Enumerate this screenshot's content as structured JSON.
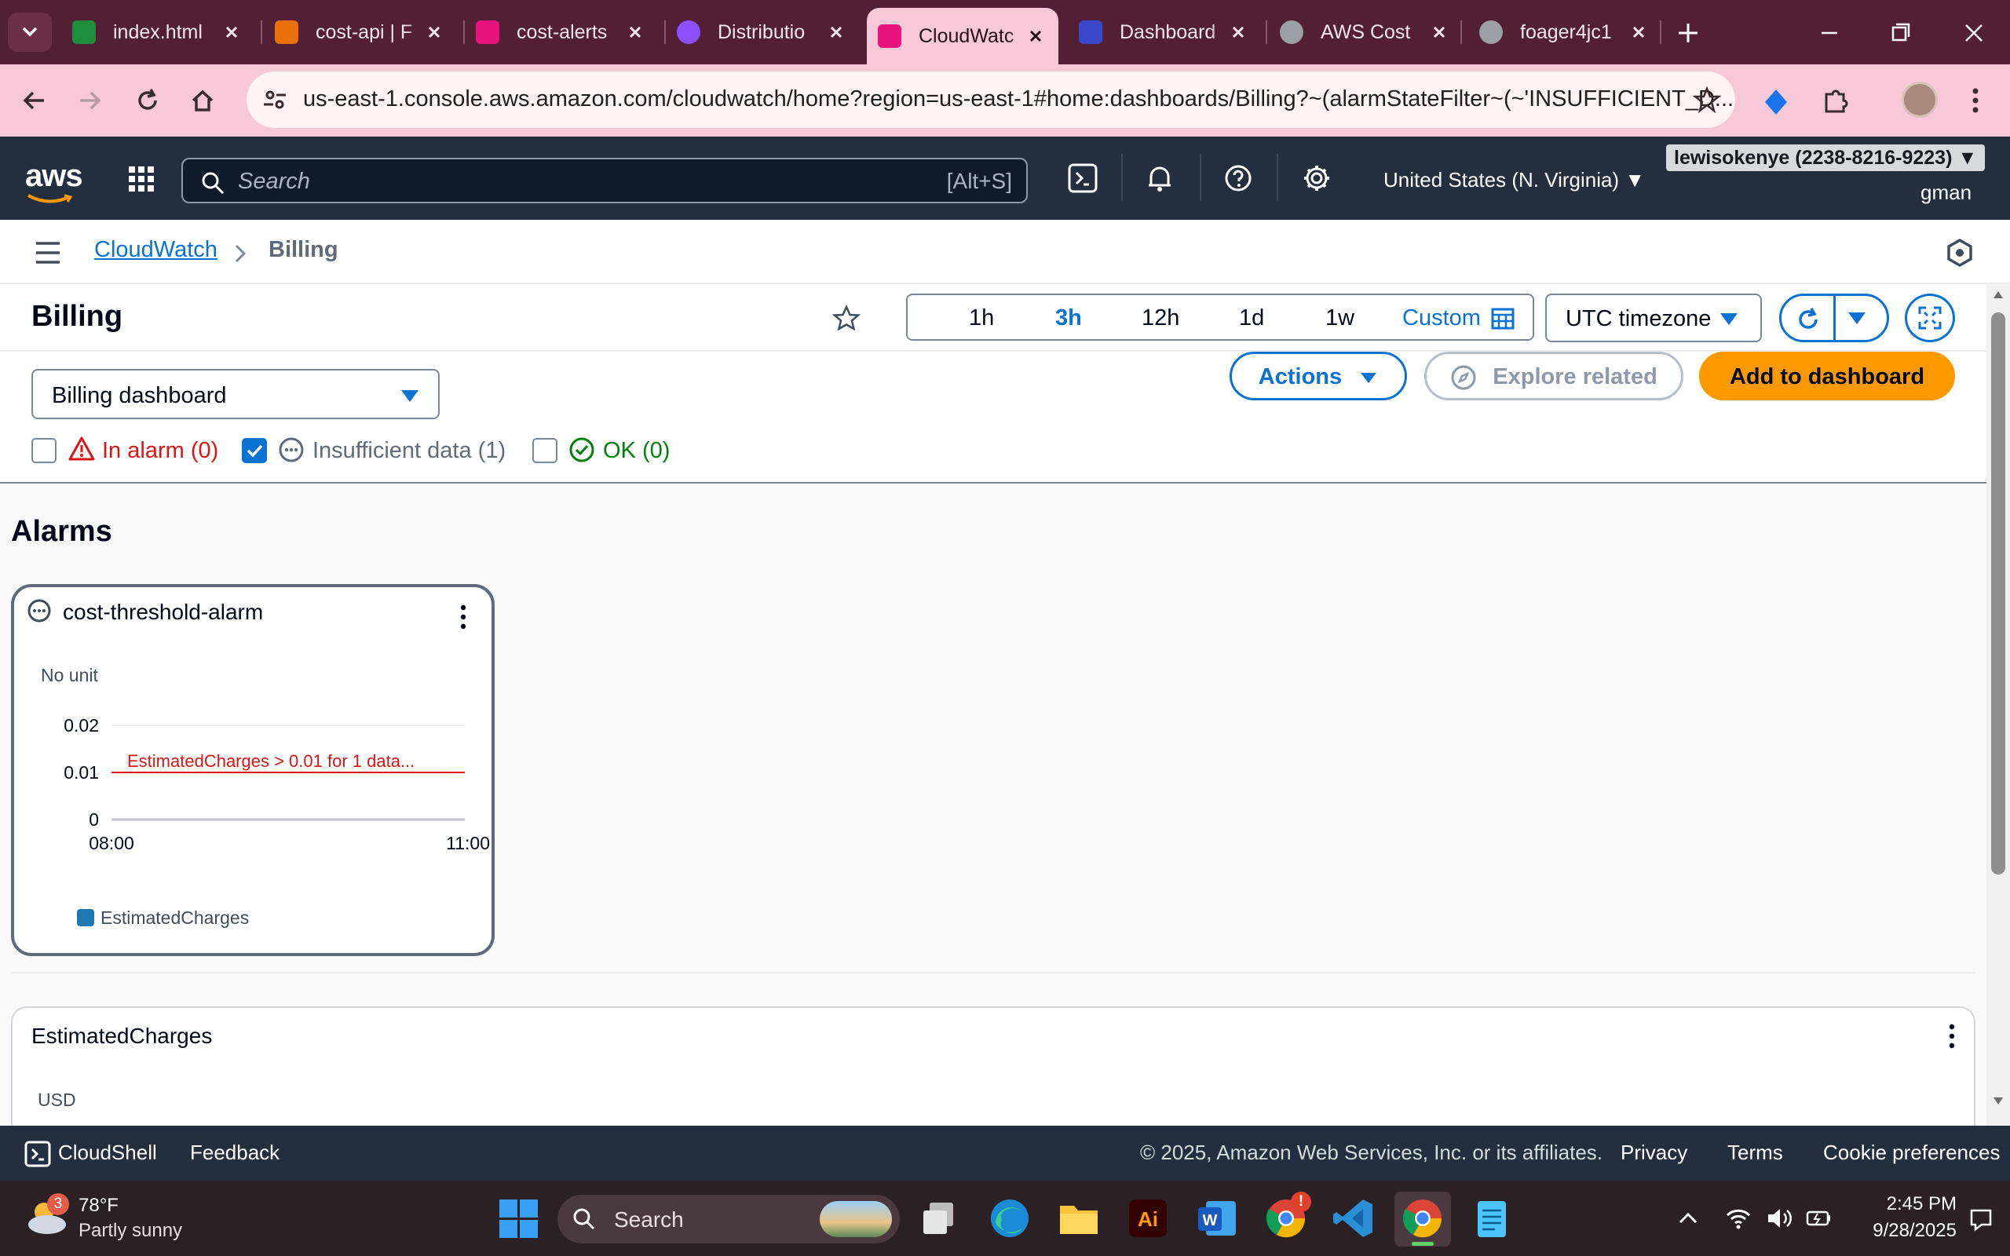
{
  "browser": {
    "tabs": [
      {
        "title": "index.html",
        "icon": "file-icon",
        "color": "#1e8e3e"
      },
      {
        "title": "cost-api | F",
        "icon": "lambda-icon",
        "color": "#e8710a"
      },
      {
        "title": "cost-alerts",
        "icon": "sns-icon",
        "color": "#e7157b"
      },
      {
        "title": "Distributio",
        "icon": "cloudfront-icon",
        "color": "#8c4fff"
      },
      {
        "title": "CloudWatc",
        "icon": "cloudwatch-icon",
        "color": "#e7157b"
      },
      {
        "title": "Dashboard",
        "icon": "dashboard-icon",
        "color": "#3b48cc"
      },
      {
        "title": "AWS Cost",
        "icon": "globe-icon",
        "color": "#9aa0a6"
      },
      {
        "title": "foager4jc1",
        "icon": "globe-icon",
        "color": "#9aa0a6"
      }
    ],
    "url": "us-east-1.console.aws.amazon.com/cloudwatch/home?region=us-east-1#home:dashboards/Billing?~(alarmStateFilter~(~'INSUFFICIENT_D..."
  },
  "aws_nav": {
    "logo": "aws",
    "search_placeholder": "Search",
    "search_shortcut": "[Alt+S]",
    "region": "United States (N. Virginia) ▼",
    "account": "lewisokenye (2238-8216-9223) ▼",
    "user": "gman"
  },
  "breadcrumb": {
    "root": "CloudWatch",
    "current": "Billing"
  },
  "header": {
    "title": "Billing",
    "time_ranges": [
      "1h",
      "3h",
      "12h",
      "1d",
      "1w"
    ],
    "selected_range": "3h",
    "custom_label": "Custom",
    "timezone": "UTC timezone"
  },
  "controls": {
    "dashboard_select": "Billing dashboard",
    "actions_label": "Actions",
    "explore_label": "Explore related",
    "add_label": "Add to dashboard",
    "filters": [
      {
        "label": "In alarm (0)",
        "checked": false,
        "color": "#d91515"
      },
      {
        "label": "Insufficient data (1)",
        "checked": true,
        "color": "#5f6b7a"
      },
      {
        "label": "OK (0)",
        "checked": false,
        "color": "#037f0c"
      }
    ]
  },
  "alarms_section": {
    "title": "Alarms"
  },
  "alarm_widget": {
    "name": "cost-threshold-alarm",
    "unit": "No unit",
    "threshold_label": "EstimatedCharges > 0.01 for 1 data...",
    "legend": "EstimatedCharges",
    "legend_color": "#1f78b4"
  },
  "chart_data": {
    "type": "line",
    "ylabel": "No unit",
    "ylim": [
      0,
      0.02
    ],
    "yticks": [
      "0.02",
      "0.01",
      "0"
    ],
    "xticks": [
      "08:00",
      "11:00"
    ],
    "threshold": 0.01,
    "series": [
      {
        "name": "EstimatedCharges",
        "values": []
      }
    ]
  },
  "widget2": {
    "title": "EstimatedCharges",
    "unit": "USD"
  },
  "footer": {
    "cloudshell": "CloudShell",
    "feedback": "Feedback",
    "copyright": "© 2025, Amazon Web Services, Inc. or its affiliates.",
    "privacy": "Privacy",
    "terms": "Terms",
    "cookies": "Cookie preferences"
  },
  "taskbar": {
    "weather_temp": "78°F",
    "weather_desc": "Partly sunny",
    "weather_badge": "3",
    "search": "Search",
    "time": "2:45 PM",
    "date": "9/28/2025",
    "chrome_badge": "!"
  }
}
